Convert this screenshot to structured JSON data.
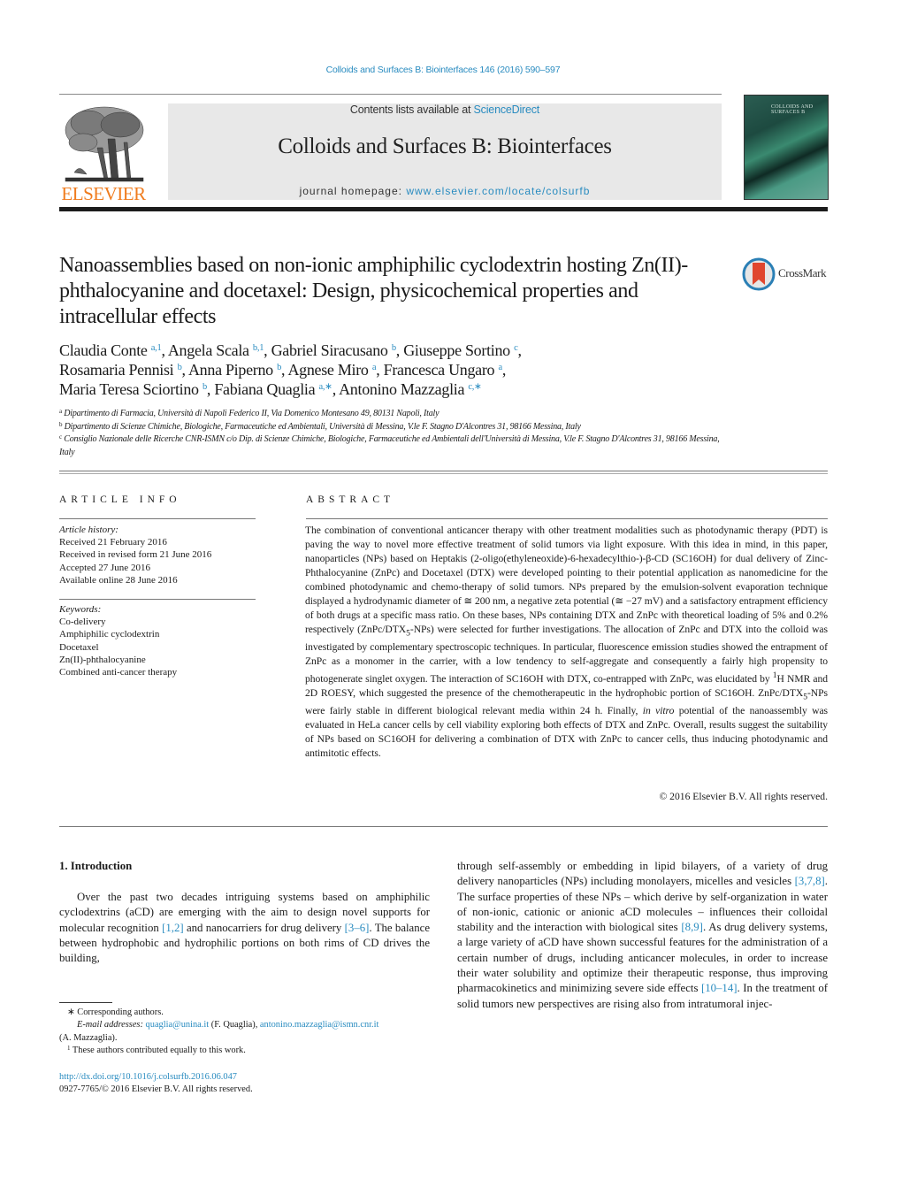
{
  "header": {
    "citation": "Colloids and Surfaces B: Biointerfaces 146 (2016) 590–597",
    "contents_prefix": "Contents lists available at ",
    "contents_link": "ScienceDirect",
    "journal_name": "Colloids and Surfaces B: Biointerfaces",
    "homepage_prefix": "journal homepage: ",
    "homepage_link": "www.elsevier.com/locate/colsurfb",
    "publisher_logo_text": "ELSEVIER",
    "cover_title": "COLLOIDS AND SURFACES B",
    "crossmark_label": "CrossMark"
  },
  "colors": {
    "link": "#2a8cc0",
    "elsevier_orange": "#f07c1e",
    "masthead_band": "#e8e8e8",
    "cover_green": "#2b5d52"
  },
  "article": {
    "title": "Nanoassemblies based on non-ionic amphiphilic cyclodextrin hosting Zn(II)-phthalocyanine and docetaxel: Design, physicochemical properties and intracellular effects",
    "authors": [
      {
        "name": "Claudia Conte",
        "sup": "a,1",
        "sep": ", "
      },
      {
        "name": "Angela Scala",
        "sup": "b,1",
        "sep": ", "
      },
      {
        "name": "Gabriel Siracusano",
        "sup": "b",
        "sep": ", "
      },
      {
        "name": "Giuseppe Sortino",
        "sup": "c",
        "sep": ","
      },
      {
        "name": "Rosamaria Pennisi",
        "sup": "b",
        "sep": ", "
      },
      {
        "name": "Anna Piperno",
        "sup": "b",
        "sep": ", "
      },
      {
        "name": "Agnese Miro",
        "sup": "a",
        "sep": ", "
      },
      {
        "name": "Francesca Ungaro",
        "sup": "a",
        "sep": ","
      },
      {
        "name": "Maria Teresa Sciortino",
        "sup": "b",
        "sep": ", "
      },
      {
        "name": "Fabiana Quaglia",
        "sup": "a,∗",
        "sep": ", "
      },
      {
        "name": "Antonino Mazzaglia",
        "sup": "c,∗",
        "sep": ""
      }
    ],
    "affiliations": [
      {
        "key": "a",
        "text": "Dipartimento di Farmacia, Università di Napoli Federico II, Via Domenico Montesano 49, 80131 Napoli, Italy"
      },
      {
        "key": "b",
        "text": "Dipartimento di Scienze Chimiche, Biologiche, Farmaceutiche ed Ambientali, Università di Messina, V.le F. Stagno D'Alcontres 31, 98166 Messina, Italy"
      },
      {
        "key": "c",
        "text": "Consiglio Nazionale delle Ricerche CNR-ISMN c/o Dip. di Scienze Chimiche, Biologiche, Farmaceutiche ed Ambientali dell'Università di Messina, V.le F. Stagno D'Alcontres 31, 98166 Messina, Italy"
      }
    ]
  },
  "article_info": {
    "heading": "ARTICLE INFO",
    "history_label": "Article history:",
    "history": [
      "Received 21 February 2016",
      "Received in revised form 21 June 2016",
      "Accepted 27 June 2016",
      "Available online 28 June 2016"
    ],
    "keywords_label": "Keywords:",
    "keywords": [
      "Co-delivery",
      "Amphiphilic cyclodextrin",
      "Docetaxel",
      "Zn(II)-phthalocyanine",
      "Combined anti-cancer therapy"
    ]
  },
  "abstract": {
    "heading": "ABSTRACT",
    "parts": {
      "p1": "The combination of conventional anticancer therapy with other treatment modalities such as photodynamic therapy (PDT) is paving the way to novel more effective treatment of solid tumors via light exposure. With this idea in mind, in this paper, nanoparticles (NPs) based on Heptakis (2-oligo(ethyleneoxide)-6-hexadecylthio-)-β-CD (SC16OH) for dual delivery of Zinc-Phthalocyanine (ZnPc) and Docetaxel (DTX) were developed pointing to their potential application as nanomedicine for the combined photodynamic and chemo-therapy of solid tumors. NPs prepared by the emulsion-solvent evaporation technique displayed a hydrodynamic diameter of ≅ 200 nm, a negative zeta potential (≅ −27 mV) and a satisfactory entrapment efficiency of both drugs at a specific mass ratio. On these bases, NPs containing DTX and ZnPc with theoretical loading of 5% and 0.2% respectively (ZnPc/DTX",
      "sub1": "5",
      "p2": "-NPs) were selected for further investigations. The allocation of ZnPc and DTX into the colloid was investigated by complementary spectroscopic techniques. In particular, fluorescence emission studies showed the entrapment of ZnPc as a monomer in the carrier, with a low tendency to self-aggregate and consequently a fairly high propensity to photogenerate singlet oxygen. The interaction of SC16OH with DTX, co-entrapped with ZnPc, was elucidated by ",
      "sup1": "1",
      "p3": "H NMR and 2D ROESY, which suggested the presence of the chemotherapeutic in the hydrophobic portion of SC16OH. ZnPc/DTX",
      "sub2": "5",
      "p4": "-NPs were fairly stable in different biological relevant media within 24 h. Finally, ",
      "italic": "in vitro",
      "p5": " potential of the nanoassembly was evaluated in HeLa cancer cells by cell viability exploring both effects of DTX and ZnPc. Overall, results suggest the suitability of NPs based on SC16OH for delivering a combination of DTX with ZnPc to cancer cells, thus inducing photodynamic and antimitotic effects."
    },
    "copyright": "© 2016 Elsevier B.V. All rights reserved."
  },
  "body": {
    "intro_heading": "1.  Introduction",
    "left": {
      "t1": "Over the past two decades intriguing systems based on amphiphilic cyclodextrins (aCD) are emerging with the aim to design novel supports for molecular recognition ",
      "r1": "[1,2]",
      "t2": " and nanocarriers for drug delivery ",
      "r2": "[3–6]",
      "t3": ". The balance between hydrophobic and hydrophilic portions on both rims of CD drives the building,"
    },
    "right": {
      "t1": "through self-assembly or embedding in lipid bilayers, of a variety of drug delivery nanoparticles (NPs) including monolayers, micelles and vesicles ",
      "r1": "[3,7,8]",
      "t2": ". The surface properties of these NPs – which derive by self-organization in water of non-ionic, cationic or anionic aCD molecules – influences their colloidal stability and the interaction with biological sites ",
      "r2": "[8,9]",
      "t3": ". As drug delivery systems, a large variety of aCD have shown successful features for the administration of a certain number of drugs, including anticancer molecules, in order to increase their water solubility and optimize their therapeutic response, thus improving pharmacokinetics and minimizing severe side effects ",
      "r3": "[10–14]",
      "t4": ". In the treatment of solid tumors new perspectives are rising also from intratumoral injec-"
    }
  },
  "footnotes": {
    "corresponding": "∗  Corresponding authors.",
    "email_label": "E-mail addresses:",
    "email1": "quaglia@unina.it",
    "email1_name": " (F. Quaglia), ",
    "email2": "antonino.mazzaglia@ismn.cnr.it",
    "email2_name": "(A. Mazzaglia).",
    "equal_sup": "1",
    "equal_text": " These authors contributed equally to this work.",
    "doi": "http://dx.doi.org/10.1016/j.colsurfb.2016.06.047",
    "issn": "0927-7765/© 2016 Elsevier B.V. All rights reserved."
  }
}
